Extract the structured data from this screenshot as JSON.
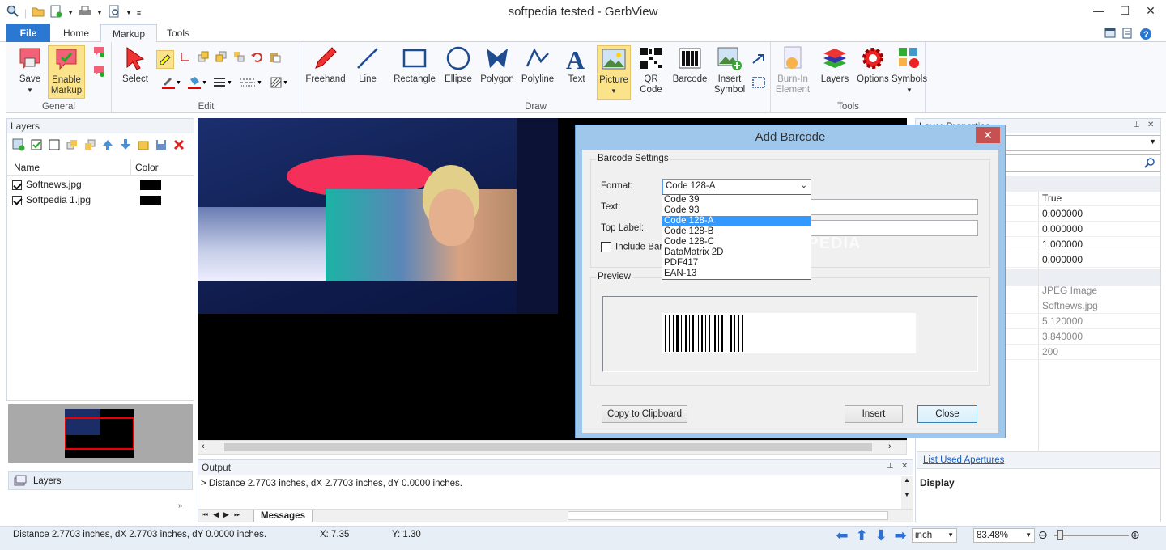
{
  "window": {
    "title": "softpedia tested - GerbView"
  },
  "tabs": {
    "file": "File",
    "home": "Home",
    "markup": "Markup",
    "tools": "Tools"
  },
  "ribbon": {
    "general": {
      "label": "General",
      "save": "Save",
      "enable_markup_1": "Enable",
      "enable_markup_2": "Markup"
    },
    "edit": {
      "label": "Edit",
      "select": "Select"
    },
    "draw": {
      "label": "Draw",
      "freehand": "Freehand",
      "line": "Line",
      "rectangle": "Rectangle",
      "ellipse": "Ellipse",
      "polygon": "Polygon",
      "polyline": "Polyline",
      "text": "Text",
      "picture": "Picture",
      "qr_1": "QR",
      "qr_2": "Code",
      "barcode": "Barcode",
      "insert_1": "Insert",
      "insert_2": "Symbol"
    },
    "tools": {
      "label": "Tools",
      "burn_1": "Burn-In",
      "burn_2": "Element",
      "layers": "Layers",
      "options": "Options",
      "symbols": "Symbols"
    }
  },
  "layers_panel": {
    "title": "Layers",
    "col_name": "Name",
    "col_color": "Color",
    "items": [
      {
        "name": "Softnews.jpg",
        "color": "#000000"
      },
      {
        "name": "Softpedia 1.jpg",
        "color": "#000000"
      }
    ],
    "bottom_tab": "Layers"
  },
  "output": {
    "title": "Output",
    "text": "> Distance 2.7703 inches, dX 2.7703 inches, dY 0.0000 inches.",
    "tab": "Messages"
  },
  "dialog": {
    "title": "Add Barcode",
    "settings_group": "Barcode Settings",
    "format_label": "Format:",
    "format_value": "Code 128-A",
    "text_label": "Text:",
    "top_label": "Top Label:",
    "include_label": "Include Barco",
    "options": [
      "Code 39",
      "Code 93",
      "Code 128-A",
      "Code 128-B",
      "Code 128-C",
      "DataMatrix 2D",
      "PDF417",
      "EAN-13"
    ],
    "preview_group": "Preview",
    "copy_btn": "Copy to Clipboard",
    "insert_btn": "Insert",
    "close_btn": "Close",
    "watermark": "SOFTPEDIA"
  },
  "properties": {
    "title": "Layer Properties",
    "values": [
      "True",
      "0.000000",
      "0.000000",
      "1.000000",
      "0.000000"
    ],
    "values2": [
      "JPEG Image",
      "Softnews.jpg",
      "5.120000",
      "3.840000",
      "200"
    ],
    "link": "List Used Apertures",
    "display": "Display"
  },
  "status": {
    "distance": "Distance 2.7703 inches, dX 2.7703 inches, dY 0.0000 inches.",
    "x": "X: 7.35",
    "y": "Y: 1.30",
    "unit": "inch",
    "zoom": "83.48%"
  },
  "colors": {
    "accent": "#2b78d3",
    "highlight": "#3399ff",
    "dialog_frame": "#9fc7ec"
  }
}
